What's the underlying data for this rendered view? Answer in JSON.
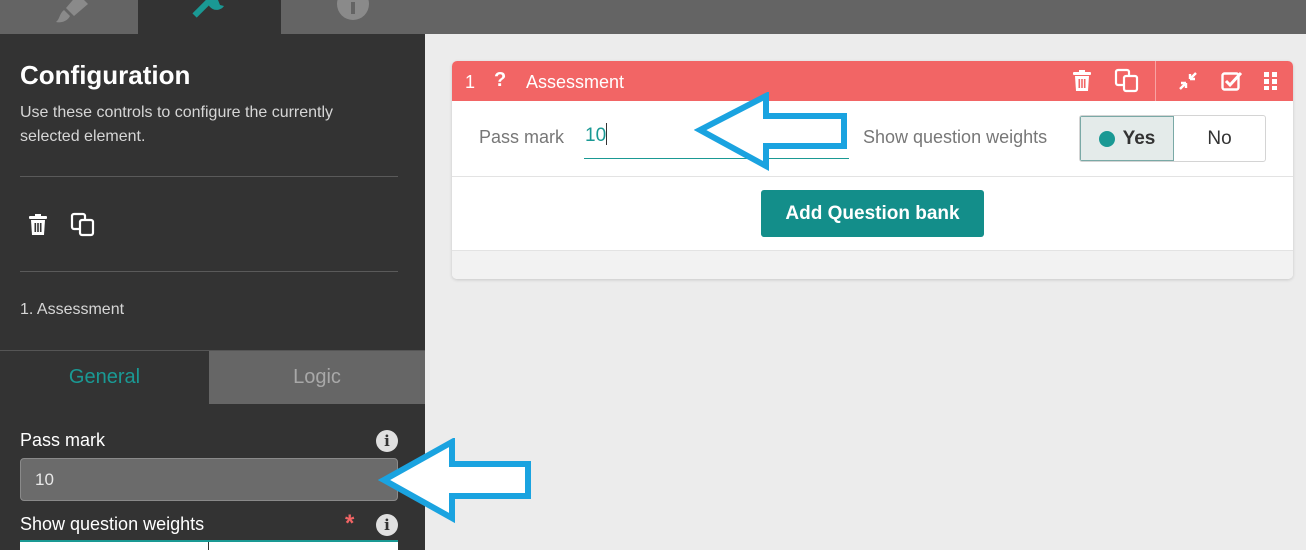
{
  "top_tabs": {
    "appearance_icon": "paintbrush-icon",
    "config_icon": "wrench-icon",
    "info_icon": "info-icon"
  },
  "config_panel": {
    "title": "Configuration",
    "description": "Use these controls to configure the currently selected element.",
    "actions": [
      "trash-icon",
      "copy-icon"
    ],
    "breadcrumb": "1. Assessment",
    "tabs": [
      {
        "label": "General",
        "active": true
      },
      {
        "label": "Logic",
        "active": false
      }
    ],
    "fields": {
      "pass_mark_label": "Pass mark",
      "pass_mark_value": "10",
      "show_weights_label": "Show question weights",
      "required_marker": "*"
    }
  },
  "card": {
    "number": "1",
    "type_glyph": "?",
    "title": "Assessment",
    "header_actions": [
      "trash-icon",
      "copy-icon",
      "collapse-icon",
      "check-square-icon",
      "drag-grid-icon"
    ],
    "pass_mark_label": "Pass mark",
    "pass_mark_value": "10",
    "show_weights_label": "Show question weights",
    "yes_label": "Yes",
    "no_label": "No",
    "selected": "Yes",
    "add_button": "Add Question bank"
  },
  "colors": {
    "accent": "#1a9994",
    "header": "#f26565",
    "panel": "#333333",
    "annotation": "#1aa3e0"
  }
}
